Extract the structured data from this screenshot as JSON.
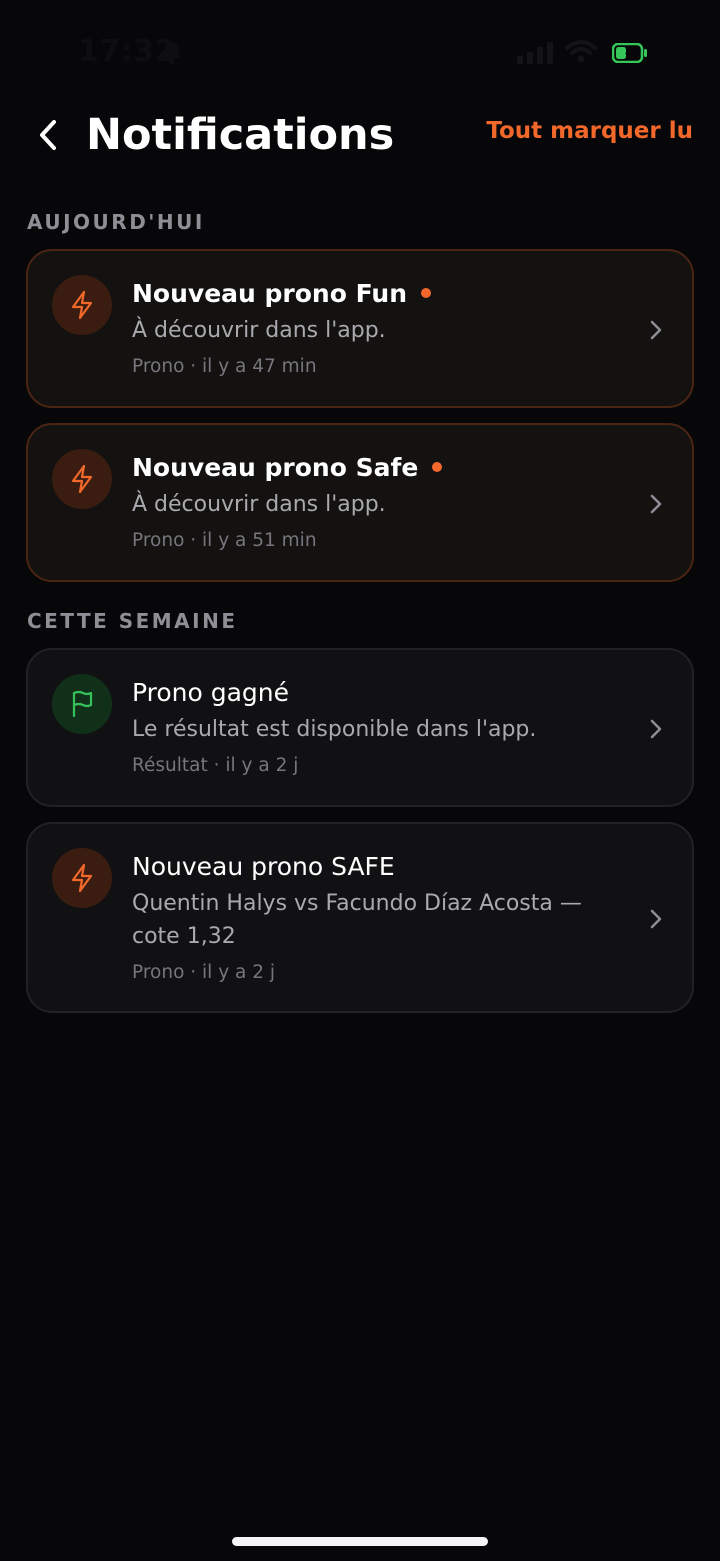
{
  "status_bar": {
    "time": "17:32",
    "icons": [
      "bell-icon",
      "signal-icon",
      "wifi-icon",
      "battery-charging-icon"
    ],
    "battery_color": "#35c759"
  },
  "header": {
    "title": "Notifications",
    "mark_all_read": "Tout marquer lu",
    "back_icon": "chevron-left-icon"
  },
  "colors": {
    "accent": "#f2682a",
    "success": "#36c25a",
    "background": "#070709"
  },
  "sections": [
    {
      "label": "AUJOURD'HUI",
      "items": [
        {
          "icon": "lightning-icon",
          "title": "Nouveau prono Fun",
          "unread": true,
          "description": "À découvrir dans l'app.",
          "meta": "Prono · il y a 47 min"
        },
        {
          "icon": "lightning-icon",
          "title": "Nouveau prono Safe",
          "unread": true,
          "description": "À découvrir dans l'app.",
          "meta": "Prono · il y a 51 min"
        }
      ]
    },
    {
      "label": "CETTE SEMAINE",
      "items": [
        {
          "icon": "flag-icon",
          "title": "Prono gagné",
          "unread": false,
          "description": "Le résultat est disponible dans l'app.",
          "meta": "Résultat · il y a 2 j"
        },
        {
          "icon": "lightning-icon",
          "title": "Nouveau prono SAFE",
          "unread": false,
          "description": "Quentin Halys vs Facundo Díaz Acosta — cote 1,32",
          "meta": "Prono · il y a 2 j"
        }
      ]
    }
  ]
}
